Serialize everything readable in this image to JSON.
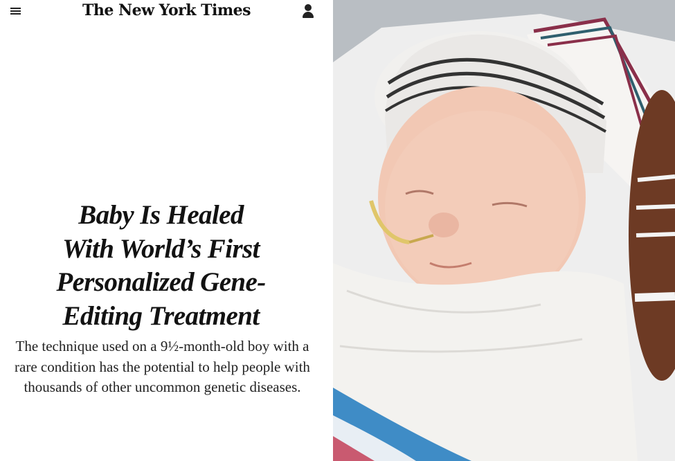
{
  "header": {
    "logo_text": "The New York Times",
    "menu_icon": "hamburger-menu-icon",
    "account_icon": "user-account-icon"
  },
  "article": {
    "headline_lines": [
      "Baby Is Healed",
      "With World’s First",
      "Personalized Gene-",
      "Editing Treatment"
    ],
    "summary": "The technique used on a 9½-month-old boy with a rare condition has the potential to help people with thousands of other uncommon genetic diseases."
  },
  "colors": {
    "text": "#121212",
    "background": "#ffffff"
  }
}
